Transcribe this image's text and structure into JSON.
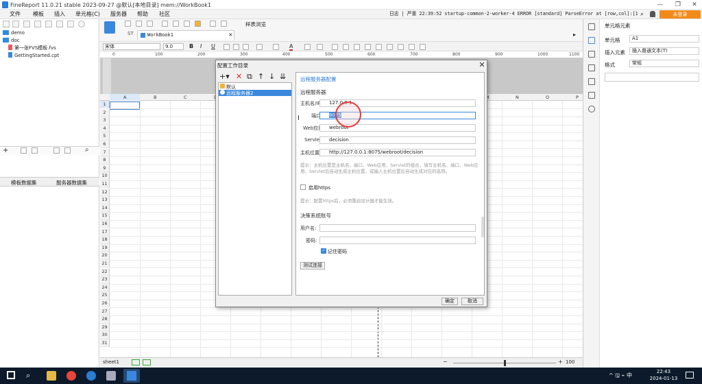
{
  "titlebar": {
    "title": "FineReport 11.0.21 stable 2023-09-27 @默认[本地目录]   mem://WorkBook1",
    "minimize": "—",
    "restore": "❐",
    "close": "✕"
  },
  "menu": [
    "文件",
    "模板",
    "插入",
    "单元格(C)",
    "服务器",
    "帮助",
    "社区"
  ],
  "status_message": "日志 | 严重 22:39:52 startup-common-2-worker-4 ERROR [standard] ParseError at [row,col]:[1,1]Mess...",
  "login_button": "未登录",
  "left_tree": [
    {
      "label": "demo",
      "kind": "folder"
    },
    {
      "label": "doc",
      "kind": "folder"
    },
    {
      "label": "第一张FVS模板.fvs",
      "kind": "file"
    },
    {
      "label": "GettingStarted.cpt",
      "kind": "file"
    }
  ],
  "dataset_tabs": {
    "template": "模板数据集",
    "server": "服务器数据集"
  },
  "toolbar": {
    "workbook_tab": "WorkBook1",
    "tab_close": "×",
    "tab_icon_label": "ST",
    "preview_label": "样表浏览"
  },
  "format_bar": {
    "font": "宋体",
    "size": "9.0",
    "bold": "B",
    "italic": "I",
    "underline": "U",
    "font_color": "A",
    "fx": "fx"
  },
  "ruler_ticks": [
    "0",
    "100",
    "200",
    "300",
    "400",
    "500",
    "600",
    "700",
    "800",
    "900",
    "1000",
    "1100"
  ],
  "columns": [
    "A",
    "B",
    "C",
    "D",
    "E",
    "F",
    "G",
    "H",
    "I",
    "J",
    "K",
    "L",
    "M",
    "N",
    "O",
    "P"
  ],
  "rows": [
    "1",
    "2",
    "3",
    "4",
    "5",
    "6",
    "7",
    "8",
    "9",
    "10",
    "11",
    "12",
    "13",
    "14",
    "15",
    "16",
    "17",
    "18",
    "19",
    "20",
    "21",
    "22",
    "23",
    "24",
    "25",
    "26",
    "27",
    "28",
    "29",
    "30",
    "31"
  ],
  "sheet_tab": "sheet1",
  "zoom": "100",
  "zoom_minus": "−",
  "zoom_plus": "+",
  "right_panel": {
    "title": "单元格元素",
    "cell_label": "单元格",
    "cell_value": "A1",
    "insert_label": "插入元素",
    "insert_value": "插入普通文本(T)",
    "style_label": "格式",
    "style_value": "常规"
  },
  "dialog": {
    "title": "配置工作目录",
    "close": "✕",
    "toolbar_icons": [
      "+▾",
      "✕",
      "⧉",
      "↑",
      "↓",
      "⇊"
    ],
    "list_items": [
      "默认",
      "远程服务器2"
    ],
    "section_title": "远程服务器配置",
    "server_section": "远程服务器",
    "host_label": "主机名/IP:",
    "host_value": "127.0.0.1",
    "port_label": "端口:",
    "port_value": "8075",
    "web_label": "Web应用:",
    "web_value": "webroot",
    "servlet_label": "Servlet:",
    "servlet_value": "decision",
    "location_label": "主机位置:",
    "location_value": "http://127.0.0.1:8075/webroot/decision",
    "hint1": "提示：主机位置是主机名、端口、Web应用、Servlet的组合，填写主机名、端口、Web应用、Servlet后自动生成主机位置，或输入主机位置后自动生成对应的选项。",
    "https_label": "启用https",
    "hint2": "提示：配置https后，必须重启设计器才能生效。",
    "account_section": "决策系统账号",
    "user_label": "用户名:",
    "user_value": "",
    "password_label": "密码:",
    "password_value": "",
    "remember_label": "记住密码",
    "test_button": "测试连接",
    "ok_button": "确定",
    "cancel_button": "取消"
  },
  "taskbar": {
    "clock_time": "22:43",
    "clock_date": "2024-01-13",
    "ime": "中",
    "tray": "^ 🖫 ⌁ 中"
  }
}
